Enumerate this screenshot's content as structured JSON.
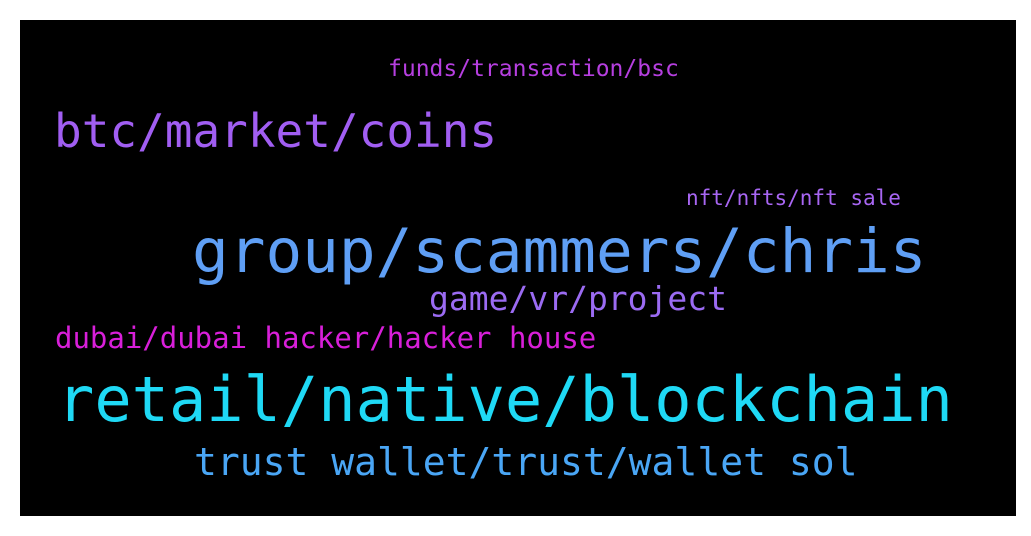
{
  "words": [
    {
      "text": "funds/transaction/bsc",
      "color": "#b63fe0"
    },
    {
      "text": "btc/market/coins",
      "color": "#a15ef2"
    },
    {
      "text": "nft/nfts/nft sale",
      "color": "#a866f3"
    },
    {
      "text": "group/scammers/chris",
      "color": "#5f9ff5"
    },
    {
      "text": "game/vr/project",
      "color": "#9b6bf2"
    },
    {
      "text": "dubai/dubai hacker/hacker house",
      "color": "#d81fd9"
    },
    {
      "text": "retail/native/blockchain",
      "color": "#1fd9f5"
    },
    {
      "text": "trust wallet/trust/wallet sol",
      "color": "#4aa6f5"
    }
  ]
}
